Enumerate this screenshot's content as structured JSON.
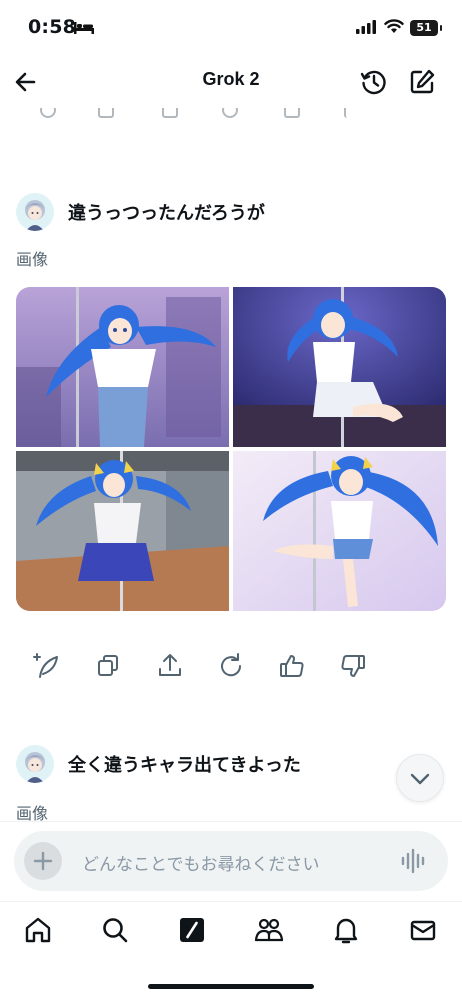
{
  "status_bar": {
    "time": "0:58",
    "battery": "51"
  },
  "header": {
    "title": "Grok 2"
  },
  "messages": [
    {
      "text": "違うっつったんだろうが",
      "label": "画像"
    },
    {
      "text": "全く違うキャラ出てきよった",
      "label": "画像"
    }
  ],
  "images": [
    {
      "description": "anime-girl-pole-dance-1"
    },
    {
      "description": "anime-girl-pole-dance-2"
    },
    {
      "description": "anime-girl-pole-dance-3"
    },
    {
      "description": "anime-girl-pole-dance-4"
    }
  ],
  "message_actions": [
    "regenerate-sparkle-icon",
    "copy-icon",
    "share-icon",
    "refresh-icon",
    "thumbs-up-icon",
    "thumbs-down-icon"
  ],
  "composer": {
    "placeholder": "どんなことでもお尋ねください"
  },
  "bottom_nav": [
    "home-icon",
    "search-icon",
    "grok-icon",
    "communities-icon",
    "notifications-icon",
    "messages-icon"
  ],
  "colors": {
    "text": "#0f1419",
    "secondary": "#536471",
    "composer_bg": "#eff3f4",
    "hair_blue": "#2f6fe0"
  }
}
